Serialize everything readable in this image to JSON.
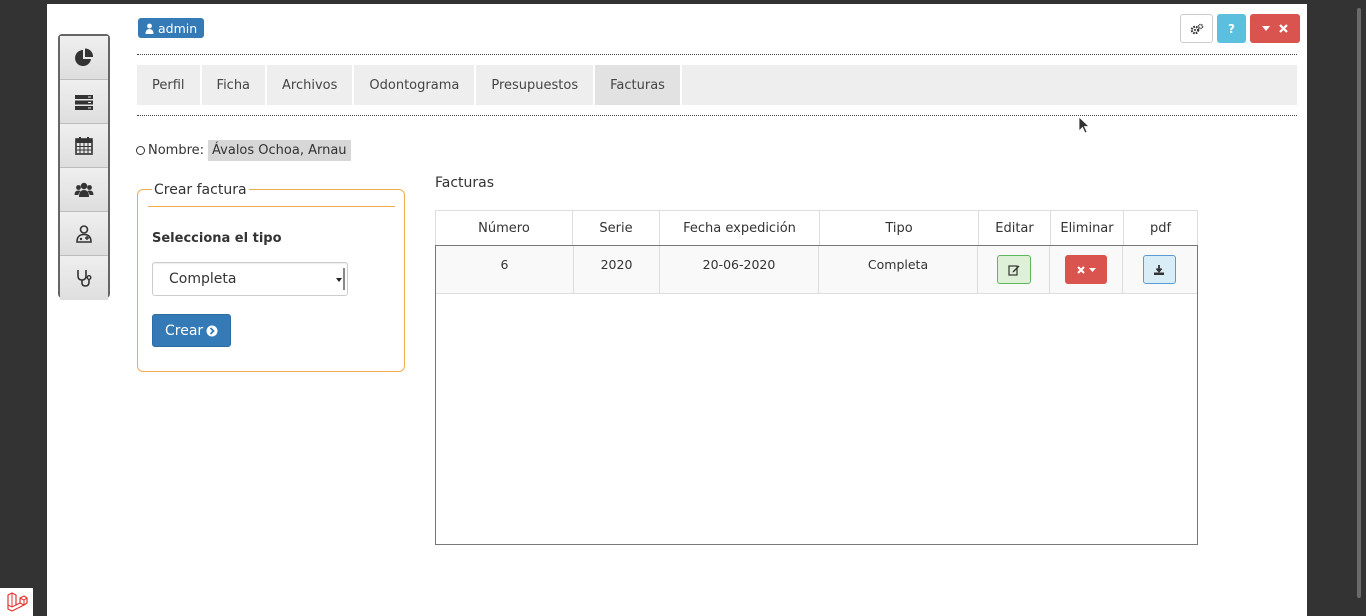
{
  "topbar": {
    "user_label": "admin",
    "help_label": "?"
  },
  "sidebar": {
    "items": [
      {
        "icon": "pie-chart-icon"
      },
      {
        "icon": "server-list-icon"
      },
      {
        "icon": "calendar-icon"
      },
      {
        "icon": "users-icon"
      },
      {
        "icon": "user-md-icon"
      },
      {
        "icon": "stethoscope-icon"
      }
    ]
  },
  "tabs": [
    {
      "label": "Perfil"
    },
    {
      "label": "Ficha"
    },
    {
      "label": "Archivos"
    },
    {
      "label": "Odontograma"
    },
    {
      "label": "Presupuestos"
    },
    {
      "label": "Facturas",
      "active": true
    }
  ],
  "patient": {
    "label": "Nombre:",
    "value": "Ávalos Ochoa, Arnau"
  },
  "crear_factura": {
    "title": "Crear factura",
    "select_label": "Selecciona el tipo",
    "selected_option": "Completa",
    "button_label": "Crear"
  },
  "facturas": {
    "title": "Facturas",
    "columns": [
      "Número",
      "Serie",
      "Fecha expedición",
      "Tipo",
      "Editar",
      "Eliminar",
      "pdf"
    ],
    "rows": [
      {
        "numero": "6",
        "serie": "2020",
        "fecha": "20-06-2020",
        "tipo": "Completa"
      }
    ]
  },
  "colors": {
    "primary": "#337ab7",
    "danger": "#d9534f",
    "info": "#5bc0de",
    "success_light": "#dff0d8",
    "fieldset_border": "#f0ad4e"
  }
}
